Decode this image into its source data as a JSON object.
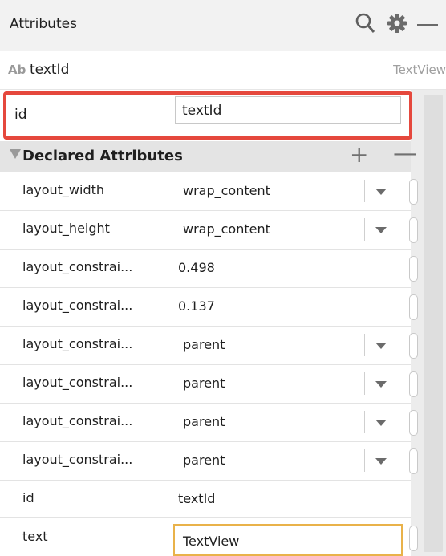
{
  "header": {
    "title": "Attributes",
    "icons": [
      "search-icon",
      "gear-icon",
      "minimize-icon"
    ]
  },
  "component": {
    "badge": "Ab",
    "name": "textId",
    "type": "TextView"
  },
  "id_field": {
    "label": "id",
    "value": "textId"
  },
  "declared": {
    "label": "Declared Attributes",
    "add": "+",
    "remove": "—"
  },
  "attributes": [
    {
      "name": "layout_width",
      "value": "wrap_content"
    },
    {
      "name": "layout_height",
      "value": "wrap_content"
    },
    {
      "name": "layout_constrai...",
      "value": "0.498"
    },
    {
      "name": "layout_constrai...",
      "value": "0.137"
    },
    {
      "name": "layout_constrai...",
      "value": "parent"
    },
    {
      "name": "layout_constrai...",
      "value": "parent"
    },
    {
      "name": "layout_constrai...",
      "value": "parent"
    },
    {
      "name": "layout_constrai...",
      "value": "parent"
    },
    {
      "name": "id",
      "value": "textId"
    },
    {
      "name": "text",
      "value": "TextView"
    }
  ],
  "colors": {
    "highlight": "#e5483d",
    "focus": "#e9b24a"
  }
}
